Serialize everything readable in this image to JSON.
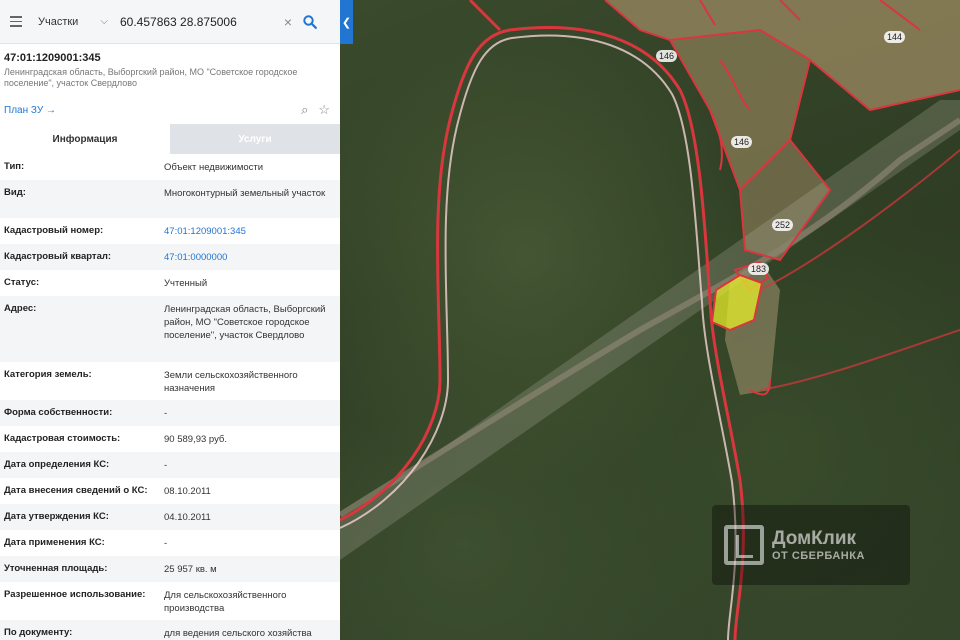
{
  "search": {
    "layer": "Участки",
    "query": "60.457863 28.875006"
  },
  "parcel": {
    "cadastral_number": "47:01:1209001:345",
    "address_short": "Ленинградская область, Выборгский район, МО \"Советское городское поселение\", участок Свердлово",
    "plan_link": "План ЗУ →"
  },
  "tabs": [
    {
      "label": "Информация",
      "active": true
    },
    {
      "label": "Услуги",
      "active": false
    }
  ],
  "rows": [
    {
      "key": "Тип:",
      "value": "Объект недвижимости"
    },
    {
      "key": "Вид:",
      "value": "Многоконтурный земельный участок"
    },
    {
      "key": "Кадастровый номер:",
      "value": "47:01:1209001:345",
      "link": true
    },
    {
      "key": "Кадастровый квартал:",
      "value": "47:01:0000000",
      "link": true
    },
    {
      "key": "Статус:",
      "value": "Учтенный"
    },
    {
      "key": "Адрес:",
      "value": "Ленинградская область, Выборгский район, МО \"Советское городское поселение\", участок Свердлово"
    },
    {
      "key": "Категория земель:",
      "value": "Земли сельскохозяйственного назначения"
    },
    {
      "key": "Форма собственности:",
      "value": "-"
    },
    {
      "key": "Кадастровая стоимость:",
      "value": "90 589,93 руб."
    },
    {
      "key": "Дата определения КС:",
      "value": "-"
    },
    {
      "key": "Дата внесения сведений о КС:",
      "value": "08.10.2011"
    },
    {
      "key": "Дата утверждения КС:",
      "value": "04.10.2011"
    },
    {
      "key": "Дата применения КС:",
      "value": "-"
    },
    {
      "key": "Уточненная площадь:",
      "value": "25 957 кв. м"
    },
    {
      "key": "Разрешенное использование:",
      "value": "Для сельскохозяйственного производства"
    },
    {
      "key": "По документу:",
      "value": "для ведения сельского хозяйства"
    }
  ],
  "map": {
    "parcel_labels": [
      "146",
      "144",
      "146",
      "252",
      "183"
    ],
    "watermark": {
      "title": "ДомКлик",
      "subtitle": "ОТ СБЕРБАНКА"
    }
  },
  "colors": {
    "accent": "#2176d2",
    "boundary": "#d9363e",
    "selected_parcel": "#e6ee2a"
  }
}
